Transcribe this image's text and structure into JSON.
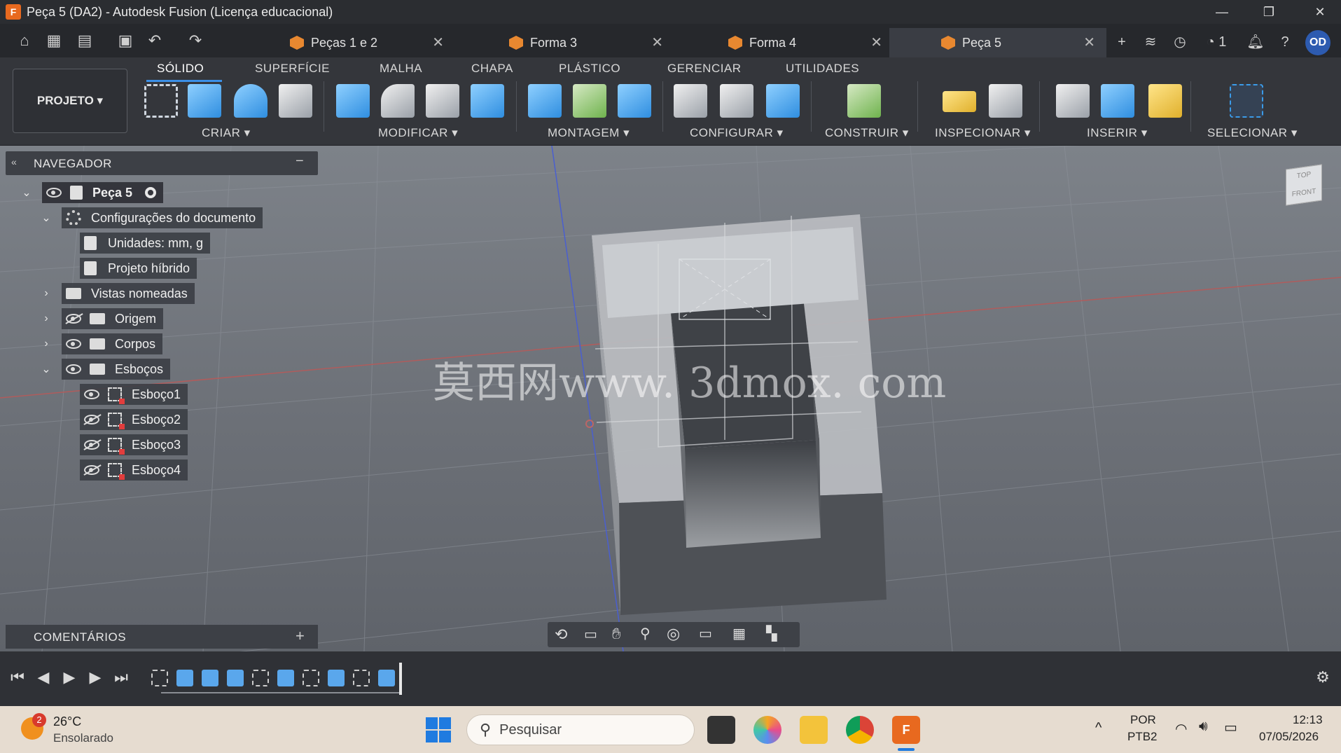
{
  "window": {
    "title": "Peça 5 (DA2) - Autodesk Fusion (Licença educacional)",
    "app_icon_letter": "F",
    "controls": [
      "—",
      "❐",
      "✕"
    ]
  },
  "tabs": [
    {
      "label": "Peças 1 e 2",
      "active": false
    },
    {
      "label": "Forma 3",
      "active": false
    },
    {
      "label": "Forma 4",
      "active": false
    },
    {
      "label": "Peça 5",
      "active": true
    }
  ],
  "tabbar_right": {
    "jobs_count": "1",
    "user_initials": "OD"
  },
  "ribbon": {
    "workspace_button": "PROJETO",
    "tabs": [
      "SÓLIDO",
      "SUPERFÍCIE",
      "MALHA",
      "CHAPA",
      "PLÁSTICO",
      "GERENCIAR",
      "UTILIDADES"
    ],
    "groups": [
      "CRIAR",
      "MODIFICAR",
      "MONTAGEM",
      "CONFIGURAR",
      "CONSTRUIR",
      "INSPECIONAR",
      "INSERIR",
      "SELECIONAR"
    ]
  },
  "navigator": {
    "title": "NAVEGADOR",
    "root": "Peça 5",
    "doc_settings": "Configurações do documento",
    "units": "Unidades: mm, g",
    "hybrid": "Projeto híbrido",
    "named_views": "Vistas nomeadas",
    "origin": "Origem",
    "bodies": "Corpos",
    "sketches": "Esboços",
    "sketch_items": [
      "Esboço1",
      "Esboço2",
      "Esboço3",
      "Esboço4"
    ]
  },
  "comments": {
    "title": "COMENTÁRIOS"
  },
  "viewcube": {
    "top": "TOP",
    "front": "FRONT"
  },
  "watermark": "莫西网www. 3dmox. com",
  "taskbar": {
    "weather_temp": "26°C",
    "weather_desc": "Ensolarado",
    "weather_badge": "2",
    "search_placeholder": "Pesquisar",
    "lang_line1": "POR",
    "lang_line2": "PTB2",
    "time": "12:13",
    "date": "07/05/2026"
  },
  "colors": {
    "accent": "#3b8fe6",
    "fusion_orange": "#e8691f"
  }
}
